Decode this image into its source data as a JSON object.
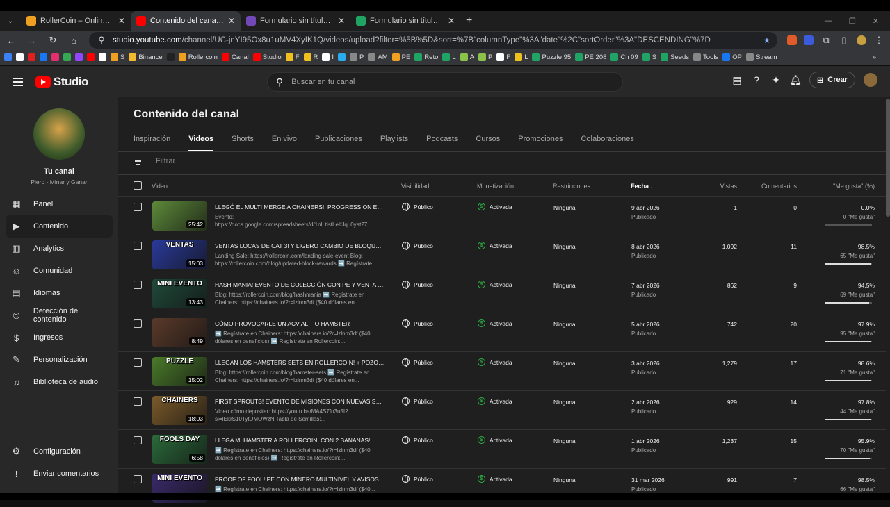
{
  "browser": {
    "tabs": [
      {
        "label": "RollerCoin – Online Bitcoin Min",
        "color": "#f0a020",
        "active": false
      },
      {
        "label": "Contenido del canal - YouTube",
        "color": "#ff0000",
        "active": true
      },
      {
        "label": "Formulario sin título - Formular",
        "color": "#7248b9",
        "active": false
      },
      {
        "label": "Formulario sin título (Respuesta",
        "color": "#1fa463",
        "active": false
      }
    ],
    "url_host": "studio.youtube.com",
    "url_path": "/channel/UC-jnYI95Ox8u1uMV4XyIK1Q/videos/upload?filter=%5B%5D&sort=%7B\"columnType\"%3A\"date\"%2C\"sortOrder\"%3A\"DESCENDING\"%7D",
    "bookmarks": [
      {
        "label": "",
        "color": "#3b82f6"
      },
      {
        "label": "",
        "color": "#ffffff"
      },
      {
        "label": "",
        "color": "#e02020"
      },
      {
        "label": "",
        "color": "#1877f2"
      },
      {
        "label": "",
        "color": "#e1306c"
      },
      {
        "label": "",
        "color": "#34a853"
      },
      {
        "label": "",
        "color": "#9146ff"
      },
      {
        "label": "",
        "color": "#ff0000"
      },
      {
        "label": "",
        "color": "#ffffff"
      },
      {
        "label": "S",
        "color": "#f0a020"
      },
      {
        "label": "Binance",
        "color": "#f3ba2f"
      },
      {
        "label": "",
        "color": "#222222"
      },
      {
        "label": "Rollercoin",
        "color": "#f0a020"
      },
      {
        "label": "Canal",
        "color": "#ff0000"
      },
      {
        "label": "Studio",
        "color": "#ff0000"
      },
      {
        "label": "F",
        "color": "#f0c020"
      },
      {
        "label": "R",
        "color": "#f0c020"
      },
      {
        "label": "I",
        "color": "#ffffff"
      },
      {
        "label": "",
        "color": "#2aabee"
      },
      {
        "label": "P",
        "color": "#888888"
      },
      {
        "label": "AM",
        "color": "#888888"
      },
      {
        "label": "PE",
        "color": "#f0a020"
      },
      {
        "label": "Reto",
        "color": "#1fa463"
      },
      {
        "label": "L",
        "color": "#1fa463"
      },
      {
        "label": "A",
        "color": "#8bc34a"
      },
      {
        "label": "P",
        "color": "#8bc34a"
      },
      {
        "label": "F",
        "color": "#ffffff"
      },
      {
        "label": "L",
        "color": "#f0c020"
      },
      {
        "label": "Puzzle 95",
        "color": "#1fa463"
      },
      {
        "label": "PE 208",
        "color": "#1fa463"
      },
      {
        "label": "Ch 09",
        "color": "#1fa463"
      },
      {
        "label": "S",
        "color": "#1fa463"
      },
      {
        "label": "Seeds",
        "color": "#1fa463"
      },
      {
        "label": "Tools",
        "color": "#888888"
      },
      {
        "label": "OP",
        "color": "#1877f2"
      },
      {
        "label": "Stream",
        "color": "#888888"
      }
    ]
  },
  "header": {
    "logo_text": "Studio",
    "search_placeholder": "Buscar en tu canal",
    "create_label": "Crear"
  },
  "sidebar": {
    "channel_name": "Tu canal",
    "channel_sub": "Piero - Minar y Ganar",
    "items": [
      {
        "label": "Panel",
        "icon": "dashboard-icon",
        "glyph": "▦",
        "active": false
      },
      {
        "label": "Contenido",
        "icon": "content-icon",
        "glyph": "▶",
        "active": true
      },
      {
        "label": "Analytics",
        "icon": "analytics-icon",
        "glyph": "▥",
        "active": false
      },
      {
        "label": "Comunidad",
        "icon": "community-icon",
        "glyph": "☺",
        "active": false
      },
      {
        "label": "Idiomas",
        "icon": "subtitles-icon",
        "glyph": "▤",
        "active": false
      },
      {
        "label": "Detección de contenido",
        "icon": "copyright-icon",
        "glyph": "©",
        "active": false
      },
      {
        "label": "Ingresos",
        "icon": "earn-icon",
        "glyph": "$",
        "active": false
      },
      {
        "label": "Personalización",
        "icon": "customization-icon",
        "glyph": "✎",
        "active": false
      },
      {
        "label": "Biblioteca de audio",
        "icon": "audio-library-icon",
        "glyph": "♫",
        "active": false
      }
    ],
    "bottom": [
      {
        "label": "Configuración",
        "icon": "settings-icon",
        "glyph": "⚙"
      },
      {
        "label": "Enviar comentarios",
        "icon": "feedback-icon",
        "glyph": "!"
      }
    ]
  },
  "main": {
    "title": "Contenido del canal",
    "tabs": [
      {
        "label": "Inspiración",
        "active": false
      },
      {
        "label": "Videos",
        "active": true
      },
      {
        "label": "Shorts",
        "active": false
      },
      {
        "label": "En vivo",
        "active": false
      },
      {
        "label": "Publicaciones",
        "active": false
      },
      {
        "label": "Playlists",
        "active": false
      },
      {
        "label": "Podcasts",
        "active": false
      },
      {
        "label": "Cursos",
        "active": false
      },
      {
        "label": "Promociones",
        "active": false
      },
      {
        "label": "Colaboraciones",
        "active": false
      }
    ],
    "filter_placeholder": "Filtrar",
    "columns": {
      "video": "Video",
      "visibility": "Visibilidad",
      "monetization": "Monetización",
      "restrictions": "Restricciones",
      "date": "Fecha",
      "views": "Vistas",
      "comments": "Comentarios",
      "likes": "\"Me gusta\" (%)"
    },
    "rows": [
      {
        "thumb_label": "",
        "thumb_color": "#5d8a3a",
        "duration": "25:42",
        "title": "LLEGÓ EL MULTI MERGE A CHAINERS!! PROGRESSION EVENT Y ...",
        "desc": "Evento: https://docs.google.com/spreadsheets/d/1nlLtistLeIfJqu0yat27...",
        "visibility": "Público",
        "monetization": "Activada",
        "restrictions": "Ninguna",
        "date": "9 abr 2026",
        "status": "Publicado",
        "views": "1",
        "comments": "0",
        "likes_pct": "0.0%",
        "likes_count": "0 \"Me gusta\"",
        "likes_fill": 0.0
      },
      {
        "thumb_label": "VENTAS",
        "thumb_color": "#2a3a9a",
        "duration": "15:03",
        "title": "VENTAS LOCAS DE CAT 3! Y LIGERO CAMBIO DE BLOQUES EN ...",
        "desc": "Landing Sale: https://rollercoin.com/landing-sale-event Blog: https://rollercoin.com/blog/updated-block-rewards ➡️ Regístrate...",
        "visibility": "Público",
        "monetization": "Activada",
        "restrictions": "Ninguna",
        "date": "8 abr 2026",
        "status": "Publicado",
        "views": "1,092",
        "comments": "11",
        "likes_pct": "98.5%",
        "likes_count": "65 \"Me gusta\"",
        "likes_fill": 0.985
      },
      {
        "thumb_label": "MINI EVENTO",
        "thumb_color": "#1f4a3a",
        "duration": "13:43",
        "title": "HASH MANIA! EVENTO DE COLECCIÓN CON PE Y VENTA MINI ...",
        "desc": "Blog: https://rollercoin.com/blog/hashmania ➡️ Regístrate en Chainers: https://chainers.io/?r=lzlnm3df ($40 dólares en...",
        "visibility": "Público",
        "monetization": "Activada",
        "restrictions": "Ninguna",
        "date": "7 abr 2026",
        "status": "Publicado",
        "views": "862",
        "comments": "9",
        "likes_pct": "94.5%",
        "likes_count": "69 \"Me gusta\"",
        "likes_fill": 0.945
      },
      {
        "thumb_label": "",
        "thumb_color": "#5a3a2a",
        "duration": "8:49",
        "title": "CÓMO PROVOCARLE UN ACV AL TIO HAMSTER",
        "desc": "➡️ Regístrate en Chainers: https://chainers.io/?r=lzlnm3df ($40 dólares en beneficios) ➡️ Regístrate en Rollercoin:...",
        "visibility": "Público",
        "monetization": "Activada",
        "restrictions": "Ninguna",
        "date": "5 abr 2026",
        "status": "Publicado",
        "views": "742",
        "comments": "20",
        "likes_pct": "97.9%",
        "likes_count": "95 \"Me gusta\"",
        "likes_fill": 0.979
      },
      {
        "thumb_label": "PUZZLE",
        "thumb_color": "#4a7a2a",
        "duration": "15:02",
        "title": "LLEGAN LOS HAMSTERS SETS EN ROLLERCOIN! + POZOLE DE ...",
        "desc": "Blog: https://rollercoin.com/blog/hamster-sets ➡️ Regístrate en Chainers: https://chainers.io/?r=lzlnm3df ($40 dólares en...",
        "visibility": "Público",
        "monetization": "Activada",
        "restrictions": "Ninguna",
        "date": "3 abr 2026",
        "status": "Publicado",
        "views": "1,279",
        "comments": "17",
        "likes_pct": "98.6%",
        "likes_count": "71 \"Me gusta\"",
        "likes_fill": 0.986
      },
      {
        "thumb_label": "CHAINERS",
        "thumb_color": "#7a5a2a",
        "duration": "18:03",
        "title": "FIRST SPROUTS! EVENTO DE MISIONES CON NUEVAS SEMILLAS ...",
        "desc": "Video cómo depositar: https://youtu.be/MA4S7fo3u5I?si=IEkrS10TytDMOWzN Tabla de Semillas:...",
        "visibility": "Público",
        "monetization": "Activada",
        "restrictions": "Ninguna",
        "date": "2 abr 2026",
        "status": "Publicado",
        "views": "929",
        "comments": "14",
        "likes_pct": "97.8%",
        "likes_count": "44 \"Me gusta\"",
        "likes_fill": 0.978
      },
      {
        "thumb_label": "FOOLS DAY",
        "thumb_color": "#2a6a3a",
        "duration": "6:58",
        "title": "LLEGA MI HAMSTER A ROLLERCOIN! CON 2 BANANAS!",
        "desc": "➡️ Regístrate en Chainers: https://chainers.io/?r=lzlnm3df ($40 dólares en beneficios) ➡️ Regístrate en Rollercoin:...",
        "visibility": "Público",
        "monetization": "Activada",
        "restrictions": "Ninguna",
        "date": "1 abr 2026",
        "status": "Publicado",
        "views": "1,237",
        "comments": "15",
        "likes_pct": "95.9%",
        "likes_count": "70 \"Me gusta\"",
        "likes_fill": 0.959
      },
      {
        "thumb_label": "MINI EVENTO",
        "thumb_color": "#3a2a6a",
        "duration": "",
        "title": "PROOF OF FOOL! PE CON MINERO MULTINIVEL Y AVISOS SOBRE...",
        "desc": "➡️ Regístrate en Chainers: https://chainers.io/?r=lzlnm3df ($40...",
        "visibility": "Público",
        "monetization": "Activada",
        "restrictions": "Ninguna",
        "date": "31 mar 2026",
        "status": "Publicado",
        "views": "991",
        "comments": "7",
        "likes_pct": "98.5%",
        "likes_count": "66 \"Me gusta\"",
        "likes_fill": 0.985
      }
    ]
  }
}
